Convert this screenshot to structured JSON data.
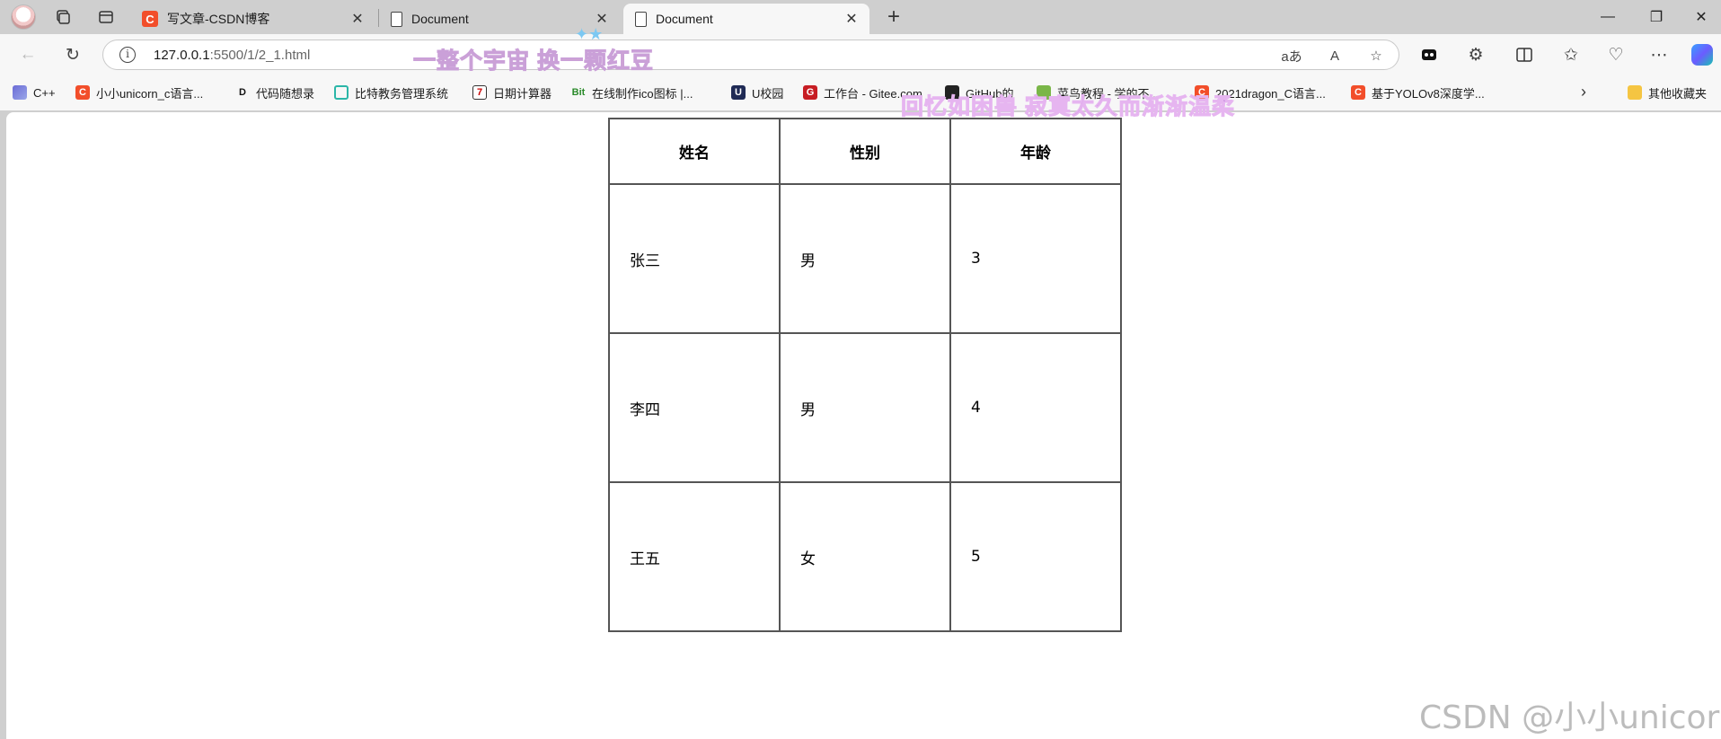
{
  "tabs": [
    {
      "title": "写文章-CSDN博客",
      "icon": "csdn-icon"
    },
    {
      "title": "Document",
      "icon": "document-icon"
    },
    {
      "title": "Document",
      "icon": "document-icon",
      "active": true
    }
  ],
  "address_bar": {
    "host": "127.0.0.1",
    "path": ":5500/1/2_1.html"
  },
  "bookmarks": [
    {
      "label": "C++"
    },
    {
      "label": "小小unicorn_c语言..."
    },
    {
      "label": "代码随想录"
    },
    {
      "label": "比特教务管理系统"
    },
    {
      "label": "日期计算器"
    },
    {
      "label": "在线制作ico图标 |..."
    },
    {
      "label": "U校园"
    },
    {
      "label": "工作台 - Gitee.com"
    },
    {
      "label": "GitHub的"
    },
    {
      "label": "菜鸟教程 - 学的不..."
    },
    {
      "label": "2021dragon_C语言..."
    },
    {
      "label": "基于YOLOv8深度学..."
    },
    {
      "label": "其他收藏夹"
    }
  ],
  "table": {
    "headers": [
      "姓名",
      "性别",
      "年龄"
    ],
    "rows": [
      [
        "张三",
        "男",
        "3"
      ],
      [
        "李四",
        "男",
        "4"
      ],
      [
        "王五",
        "女",
        "5"
      ]
    ]
  },
  "overlay": {
    "lyric_line_1": "一整个宇宙 换一颗红豆",
    "lyric_line_2": "回忆如困兽 寂寞太久而渐渐温柔",
    "watermark": "CSDN @小小unicorn"
  },
  "toolbar": {
    "read_aloud": "A",
    "translate": "aあ"
  }
}
